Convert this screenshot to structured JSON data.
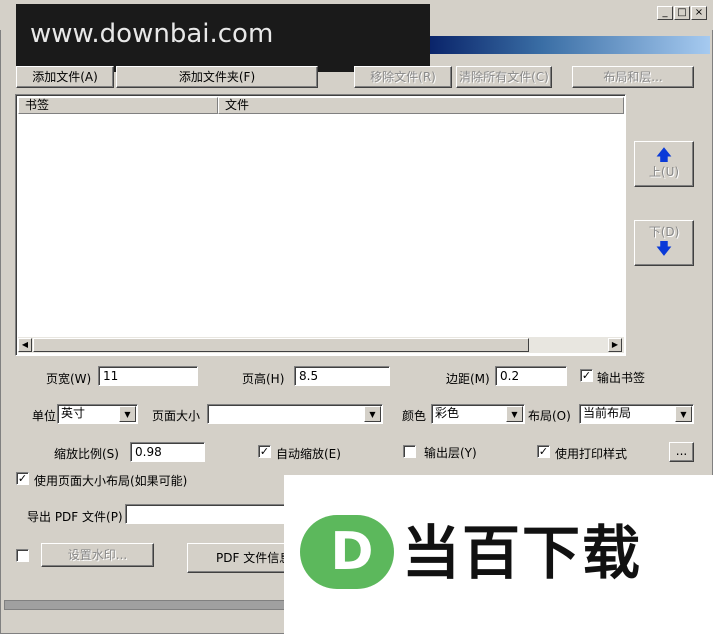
{
  "watermark": {
    "site_text": "www.downbai.com"
  },
  "window": {
    "caption_buttons": [
      "minimize",
      "maximize",
      "close"
    ]
  },
  "toolbar": {
    "add_file": "添加文件(A)",
    "add_folder": "添加文件夹(F)",
    "remove_file": "移除文件(R)",
    "clear_all": "清除所有文件(C)",
    "layout_layers": "布局和层..."
  },
  "file_list": {
    "columns": [
      "书签",
      "文件"
    ],
    "rows": []
  },
  "move_buttons": {
    "up": "上(U)",
    "down": "下(D)"
  },
  "page_settings": {
    "width_label": "页宽(W)",
    "width_value": "11",
    "height_label": "页高(H)",
    "height_value": "8.5",
    "margin_label": "边距(M)",
    "margin_value": "0.2",
    "output_bookmarks_label": "输出书签",
    "output_bookmarks_checked": true,
    "unit_label": "单位",
    "unit_value": "英寸",
    "page_size_label": "页面大小",
    "page_size_value": "",
    "color_label": "颜色",
    "color_value": "彩色",
    "layout_label": "布局(O)",
    "layout_value": "当前布局",
    "scale_label": "缩放比例(S)",
    "scale_value": "0.98",
    "auto_scale_label": "自动缩放(E)",
    "auto_scale_checked": true,
    "output_layers_label": "输出层(Y)",
    "output_layers_checked": false,
    "print_style_label": "使用打印样式",
    "print_style_checked": true,
    "ellipsis": "...",
    "page_size_layout_label": "使用页面大小布局(如果可能)",
    "page_size_layout_checked": true
  },
  "export": {
    "label": "导出 PDF 文件(P)",
    "value": ""
  },
  "bottom": {
    "watermark_checkbox_checked": false,
    "set_watermark": "设置水印...",
    "pdf_info": "PDF 文件信息"
  },
  "logo_overlay": {
    "mark_letter": "D",
    "brand_text": "当百下载",
    "mark_color": "#5cb85c"
  }
}
